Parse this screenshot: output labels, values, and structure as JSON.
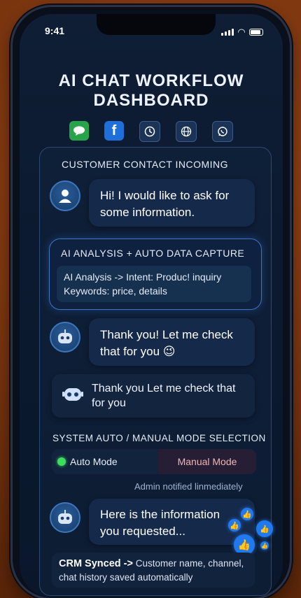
{
  "status_bar": {
    "time": "9:41"
  },
  "header": {
    "title_line1": "AI CHAT WORKFLOW",
    "title_line2": "DASHBOARD"
  },
  "channels": [
    {
      "name": "line-icon",
      "color": "#27a34a"
    },
    {
      "name": "facebook-icon",
      "color": "#1e6fd9",
      "glyph": "f"
    },
    {
      "name": "clock-icon",
      "color": "#1c3358"
    },
    {
      "name": "globe-icon",
      "color": "#1c3358"
    },
    {
      "name": "whatsapp-icon",
      "color": "#1c3358"
    }
  ],
  "conversation": {
    "incoming_label": "CUSTOMER CONTACT INCOMING",
    "customer_message": {
      "line1": "Hi! I would like to ask for",
      "line2": "some information."
    },
    "analysis": {
      "title": "AI ANALYSIS + AUTO DATA CAPTURE",
      "line1": "AI Analysis -> Intent: Produc! inquiry",
      "line2": "Keywords:  price, details"
    },
    "bot_reply_1": {
      "line1": "Thank you! Let me check",
      "line2": "that for you 😉"
    },
    "bot_reply_2": {
      "line1": "Thank you Let me check that",
      "line2": "for you"
    },
    "mode_label": "SYSTEM AUTO / MANUAL MODE SELECTION",
    "modes": {
      "auto": "Auto Mode",
      "manual": "Manual Mode"
    },
    "admin_note": "Admin notified linmediately",
    "bot_reply_3": {
      "line1": "Here is the information",
      "line2": "you requested..."
    },
    "crm": {
      "bold": "CRM Synced ->",
      "line1": "Customer name, channel,",
      "line2": "chat history saved automatically"
    }
  },
  "colors": {
    "accent": "#3f73c4",
    "auto_dot": "#3ddc5a",
    "manual_text": "#f0b4b4"
  }
}
